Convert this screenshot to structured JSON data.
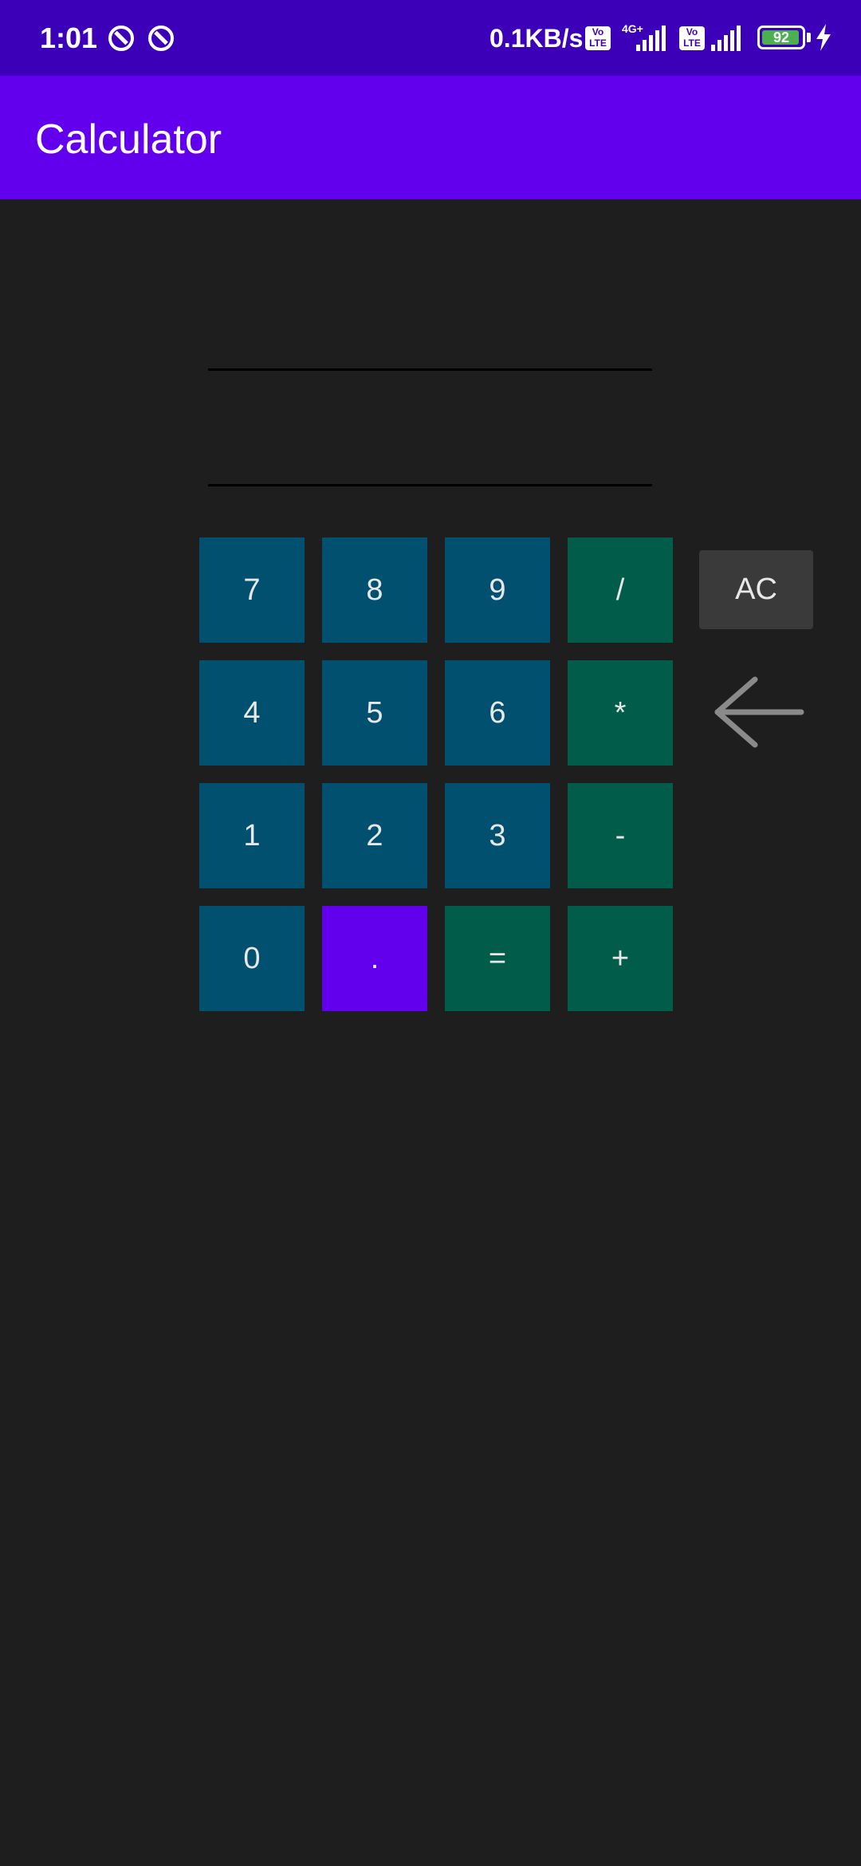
{
  "status_bar": {
    "time": "1:01",
    "network_speed": "0.1KB/s",
    "volte_label": "Vo LTE",
    "network_type": "4G+",
    "battery_level": "92",
    "icons": [
      "notification-ring-icon",
      "notification-ring-icon",
      "signal-icon",
      "signal-icon",
      "battery-icon",
      "charging-bolt-icon"
    ]
  },
  "app_bar": {
    "title": "Calculator"
  },
  "display": {
    "expression": "",
    "result": ""
  },
  "keypad": {
    "rows": [
      [
        "7",
        "8",
        "9",
        "/"
      ],
      [
        "4",
        "5",
        "6",
        "*"
      ],
      [
        "1",
        "2",
        "3",
        "-"
      ],
      [
        "0",
        ".",
        "=",
        "+"
      ]
    ]
  },
  "controls": {
    "clear_label": "AC",
    "backspace_icon": "arrow-left-icon"
  },
  "colors": {
    "status_bar": "#3b00b8",
    "app_bar": "#6200ee",
    "background": "#1e1e1e",
    "digit_key": "#01506f",
    "operator_key": "#015c4a",
    "dot_key": "#6200ee",
    "clear_key": "#3a3a3a",
    "battery_fill": "#4caf50"
  }
}
